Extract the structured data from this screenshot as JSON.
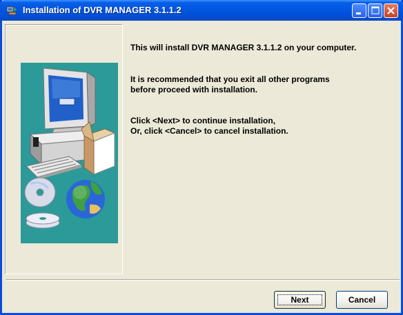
{
  "window": {
    "title": "Installation of DVR MANAGER 3.1.1.2"
  },
  "titlebar_buttons": {
    "minimize_icon": "minimize-icon",
    "maximize_icon": "maximize-icon",
    "close_icon": "close-icon"
  },
  "content": {
    "line1": "This will install DVR MANAGER 3.1.1.2 on your computer.",
    "line2a": "It is recommended that you exit all other programs",
    "line2b": "before proceed with installation.",
    "line3a": "Click <Next> to continue installation,",
    "line3b": "Or, click <Cancel> to cancel installation."
  },
  "buttons": {
    "next": "Next",
    "cancel": "Cancel"
  },
  "colors": {
    "titlebar": "#0054e3",
    "dialog_bg": "#ece9d8",
    "illustration_bg": "#2b9a98"
  }
}
